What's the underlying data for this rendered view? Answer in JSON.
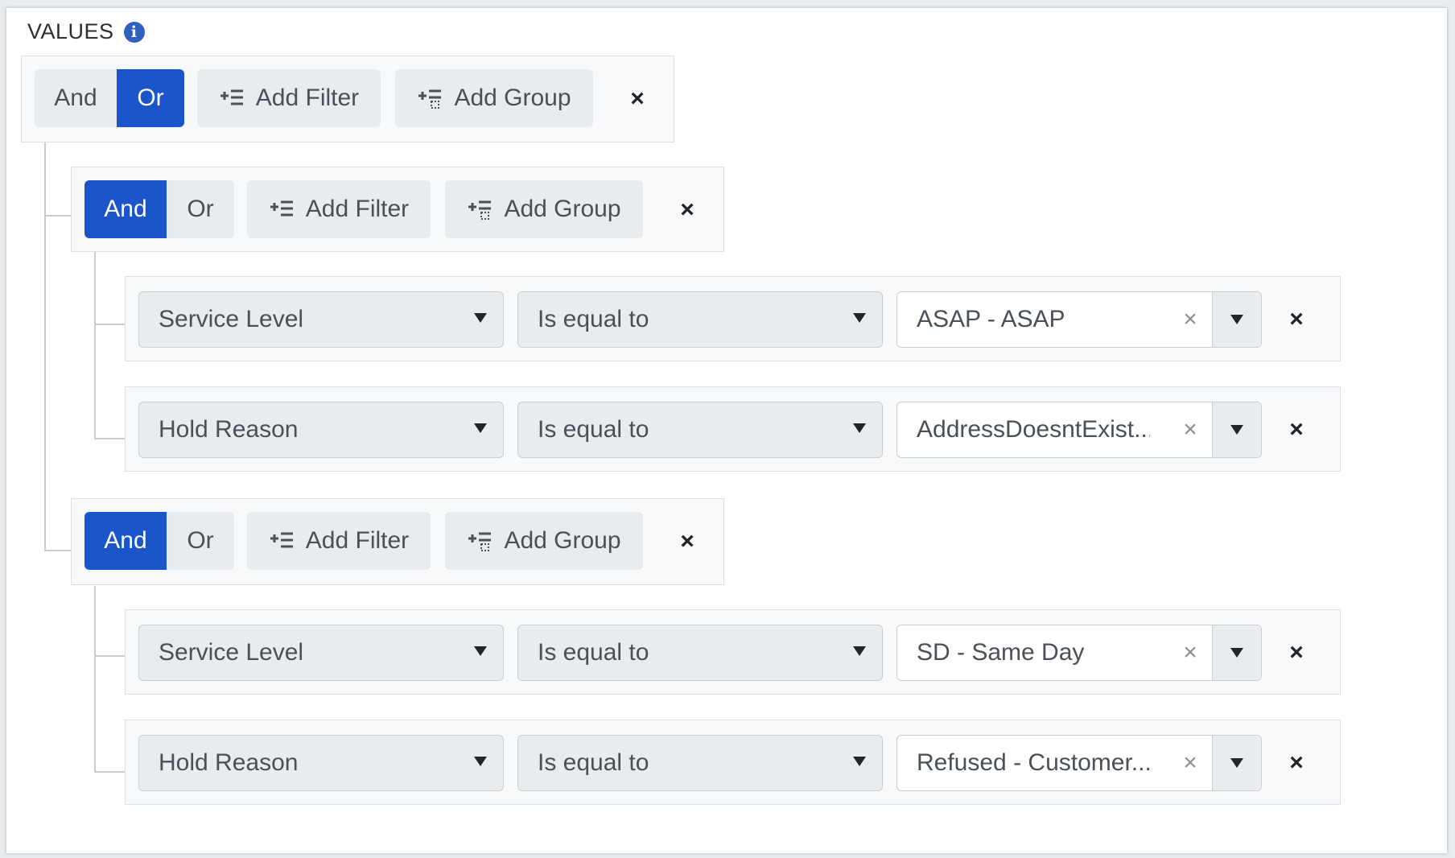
{
  "header": {
    "title": "VALUES",
    "info_icon": "info-icon"
  },
  "root_group": {
    "and_label": "And",
    "or_label": "Or",
    "active": "Or",
    "add_filter": "Add Filter",
    "add_group": "Add Group"
  },
  "groups": [
    {
      "and_label": "And",
      "or_label": "Or",
      "active": "And",
      "add_filter": "Add Filter",
      "add_group": "Add Group",
      "filters": [
        {
          "field": "Service Level",
          "operator": "Is equal to",
          "value": "ASAP - ASAP"
        },
        {
          "field": "Hold Reason",
          "operator": "Is equal to",
          "value": "AddressDoesntExist..."
        }
      ]
    },
    {
      "and_label": "And",
      "or_label": "Or",
      "active": "And",
      "add_filter": "Add Filter",
      "add_group": "Add Group",
      "filters": [
        {
          "field": "Service Level",
          "operator": "Is equal to",
          "value": "SD - Same Day"
        },
        {
          "field": "Hold Reason",
          "operator": "Is equal to",
          "value": "Refused - Customer..."
        }
      ]
    }
  ],
  "icons": {
    "remove": "×",
    "clear": "×"
  },
  "colors": {
    "accent": "#1a55c9",
    "button_bg": "#e9ecef"
  }
}
